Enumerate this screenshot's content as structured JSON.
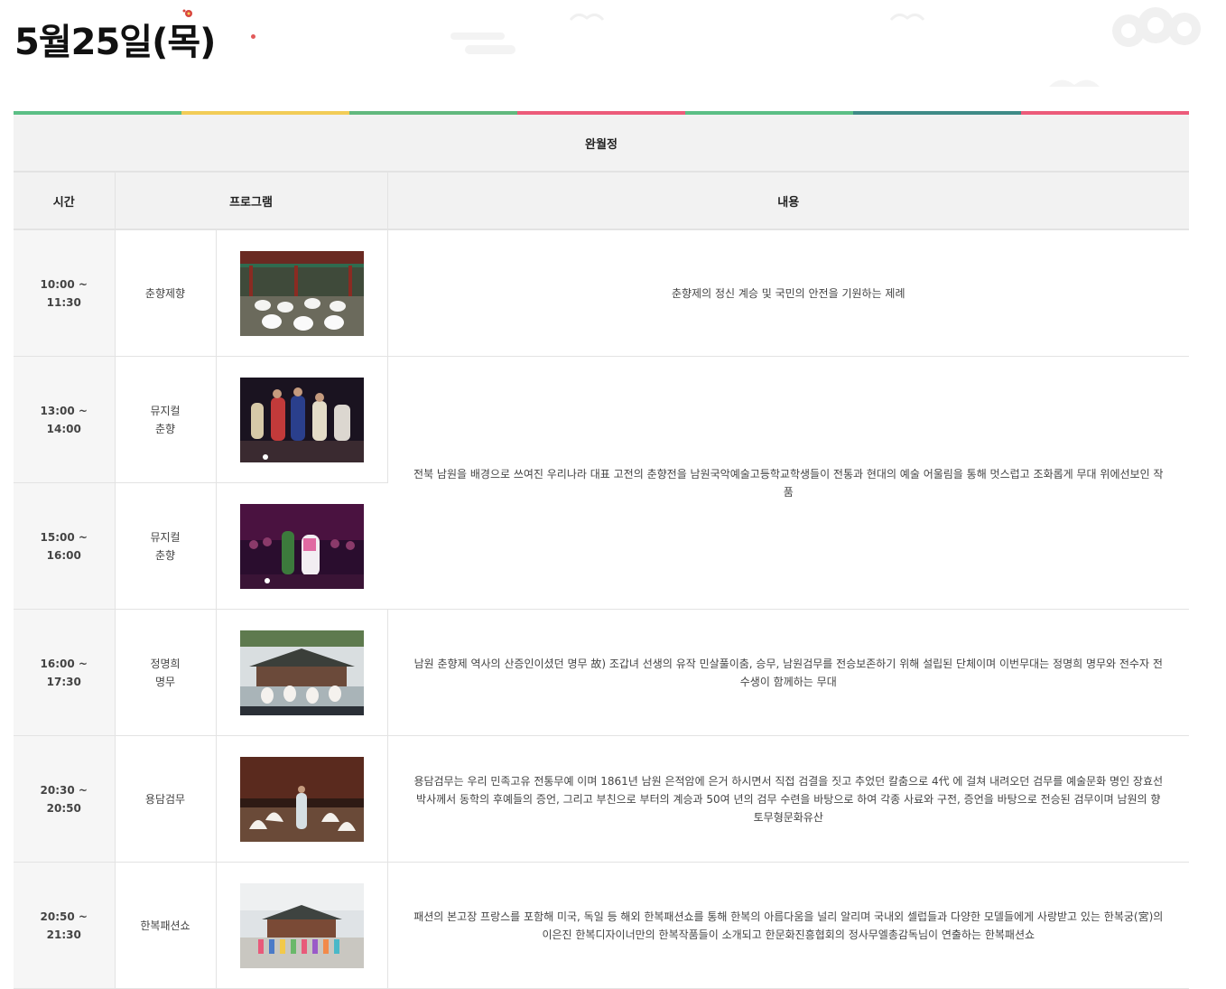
{
  "page": {
    "title": "5월25일(목)"
  },
  "stripe_colors": [
    "#5bbf86",
    "#f2cc57",
    "#62b97e",
    "#ec5b7a",
    "#5bbf86",
    "#3f8b87",
    "#ec5b7a"
  ],
  "schedule": {
    "venue": "완월정",
    "headers": {
      "time": "시간",
      "program": "프로그램",
      "content": "내용"
    },
    "rows": [
      {
        "time_start": "10:00 ~",
        "time_end": "11:30",
        "program_line1": "춘향제향",
        "program_line2": "",
        "photo": "ceremony-photo",
        "description": "춘향제의 정신 계승 및 국민의 안전을 기원하는 제례"
      },
      {
        "time_start": "13:00 ~",
        "time_end": "14:00",
        "program_line1": "뮤지컬",
        "program_line2": "춘향",
        "photo": "musical-photo",
        "description": "전북 남원을 배경으로 쓰여진 우리나라 대표 고전의 춘향전을 남원국악예술고등학교학생들이 전통과 현대의 예술 어울림을 통해 멋스럽고 조화롭게 무대 위에선보인 작품"
      },
      {
        "time_start": "15:00 ~",
        "time_end": "16:00",
        "program_line1": "뮤지컬",
        "program_line2": "춘향",
        "photo": "musical-photo",
        "description": ""
      },
      {
        "time_start": "16:00 ~",
        "time_end": "17:30",
        "program_line1": "정명희",
        "program_line2": "명무",
        "photo": "dance-photo",
        "description": "남원 춘향제 역사의 산증인이셨던 명무 故) 조갑녀 선생의 유작 민살풀이춤, 승무, 남원검무를 전승보존하기 위해 설립된 단체이며 이번무대는 정명희 명무와 전수자 전수생이 함께하는 무대"
      },
      {
        "time_start": "20:30 ~",
        "time_end": "20:50",
        "program_line1": "용담검무",
        "program_line2": "",
        "photo": "sword-dance-photo",
        "description": "용담검무는 우리 민족고유 전통무예 이며 1861년 남원 은적암에 은거 하시면서 직접 검결을 짓고 추었던 칼춤으로 4代 에 걸쳐 내려오던 검무를 예술문화 명인 장효선 박사께서 동학의 후예들의 증언, 그리고 부친으로 부터의 계승과 50여 년의 검무 수련을 바탕으로 하여 각종 사료와 구전, 증언을 바탕으로 전승된 검무이며 남원의 향토무형문화유산"
      },
      {
        "time_start": "20:50 ~",
        "time_end": "21:30",
        "program_line1": "한복패션쇼",
        "program_line2": "",
        "photo": "fashion-show-photo",
        "description": "패션의 본고장 프랑스를 포함해 미국, 독일 등 해외 한복패션쇼를 통해 한복의 아름다움을 널리 알리며 국내외 셀럽들과 다양한 모델들에게 사랑받고 있는 한복궁(宮)의 이은진 한복디자이너만의 한복작품들이 소개되고 한문화진흥협회의 정사무엘총감독님이 연출하는 한복패션쇼"
      }
    ]
  }
}
